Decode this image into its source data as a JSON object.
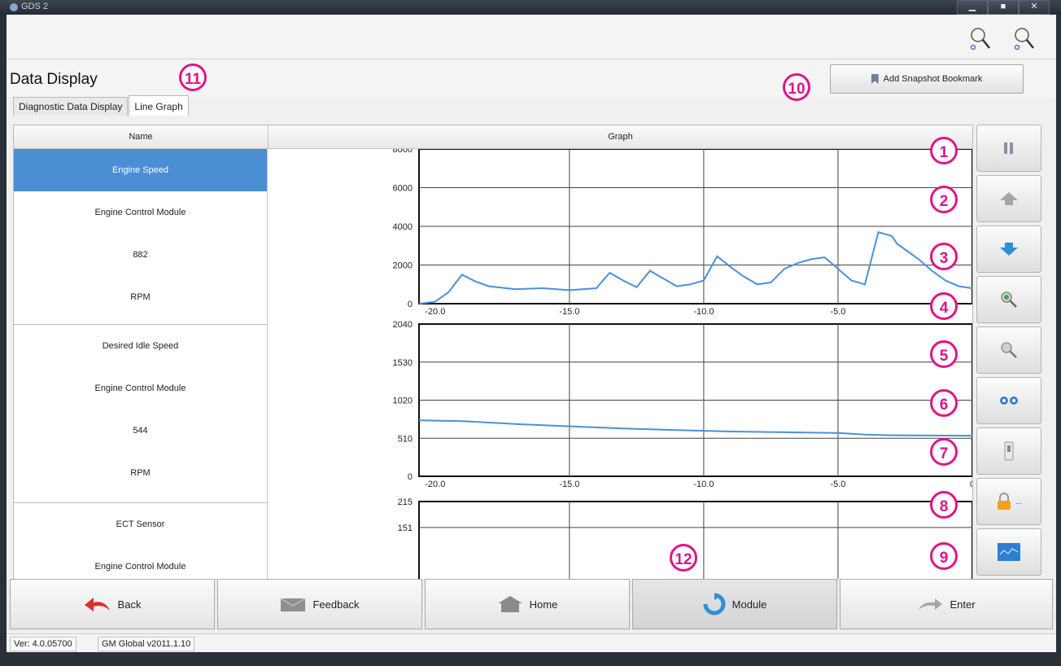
{
  "window": {
    "title": "GDS 2",
    "buttons": [
      "▁",
      "■",
      "✕"
    ]
  },
  "header": {
    "title": "Data Display",
    "snapshot_label": "Add Snapshot Bookmark"
  },
  "tabs": [
    {
      "label": "Diagnostic Data Display"
    },
    {
      "label": "Line Graph"
    }
  ],
  "table": {
    "name_header": "Name",
    "graph_header": "Graph"
  },
  "parameters": [
    {
      "lines": [
        "Engine Speed",
        "Engine Control Module",
        "882",
        "RPM"
      ],
      "selected": true
    },
    {
      "lines": [
        "Desired Idle Speed",
        "Engine Control Module",
        "544",
        "RPM"
      ],
      "selected": false
    },
    {
      "lines": [
        "ECT Sensor",
        "Engine Control Module"
      ],
      "selected": false
    }
  ],
  "callouts": [
    "1",
    "2",
    "3",
    "4",
    "5",
    "6",
    "7",
    "8",
    "9",
    "10",
    "11",
    "12"
  ],
  "side_buttons": [
    "pause-icon",
    "scroll-up-icon",
    "scroll-down-icon",
    "zoom-out-icon",
    "zoom-in-icon",
    "view-toggle-icon",
    "switch-icon",
    "lock-icon",
    "graph-icon"
  ],
  "lock_suffix": "...",
  "nav": {
    "back": "Back",
    "feedback": "Feedback",
    "home": "Home",
    "module": "Module",
    "enter": "Enter"
  },
  "status": {
    "version": "Ver: 4.0.05700",
    "database": "GM Global v2011.1.10"
  },
  "colors": {
    "selection": "#4a8fd4",
    "line": "#4a90d9",
    "callout": "#e0148a"
  },
  "chart_data": [
    {
      "type": "line",
      "x": [
        -20.6,
        -20.0,
        -19.5,
        -19.0,
        -18.5,
        -18.0,
        -17.0,
        -16.0,
        -15.0,
        -14.0,
        -13.5,
        -13.0,
        -12.5,
        -12.0,
        -11.5,
        -11.0,
        -10.5,
        -10.0,
        -9.5,
        -9.0,
        -8.5,
        -8.0,
        -7.5,
        -7.0,
        -6.5,
        -6.0,
        -5.5,
        -5.0,
        -4.5,
        -4.0,
        -3.5,
        -3.0,
        -2.8,
        -2.5,
        -2.0,
        -1.5,
        -1.0,
        -0.5,
        0.0
      ],
      "y": [
        0,
        100,
        600,
        1500,
        1150,
        900,
        750,
        800,
        700,
        800,
        1600,
        1200,
        850,
        1700,
        1300,
        900,
        1000,
        1200,
        2450,
        1900,
        1400,
        1000,
        1100,
        1800,
        2100,
        2300,
        2400,
        1800,
        1200,
        1000,
        3700,
        3500,
        3100,
        2800,
        2300,
        1700,
        1200,
        900,
        800
      ],
      "xticks": [
        "-20.0",
        "-15.0",
        "-10.0",
        "-5.0"
      ],
      "yticks": [
        "0",
        "2000",
        "4000",
        "6000",
        "8000"
      ],
      "xlim": [
        -20.6,
        0
      ],
      "ylim": [
        0,
        8000
      ],
      "grid": true
    },
    {
      "type": "line",
      "x": [
        -20.6,
        -19.0,
        -17.0,
        -15.0,
        -13.0,
        -11.0,
        -9.0,
        -7.0,
        -5.0,
        -4.0,
        -3.0,
        -1.0,
        0.0
      ],
      "y": [
        750,
        740,
        700,
        670,
        640,
        620,
        600,
        590,
        580,
        560,
        550,
        545,
        544
      ],
      "xticks": [
        "-20.0",
        "-15.0",
        "-10.0",
        "-5.0",
        "0"
      ],
      "yticks": [
        "0",
        "510",
        "1020",
        "1530",
        "2040"
      ],
      "xlim": [
        -20.6,
        0
      ],
      "ylim": [
        0,
        2040
      ],
      "grid": true
    },
    {
      "type": "line",
      "x": [],
      "y": [],
      "xticks": [],
      "yticks": [
        "151",
        "215"
      ],
      "xlim": [
        -20.6,
        0
      ],
      "ylim": [
        0,
        215
      ],
      "grid": true
    }
  ]
}
